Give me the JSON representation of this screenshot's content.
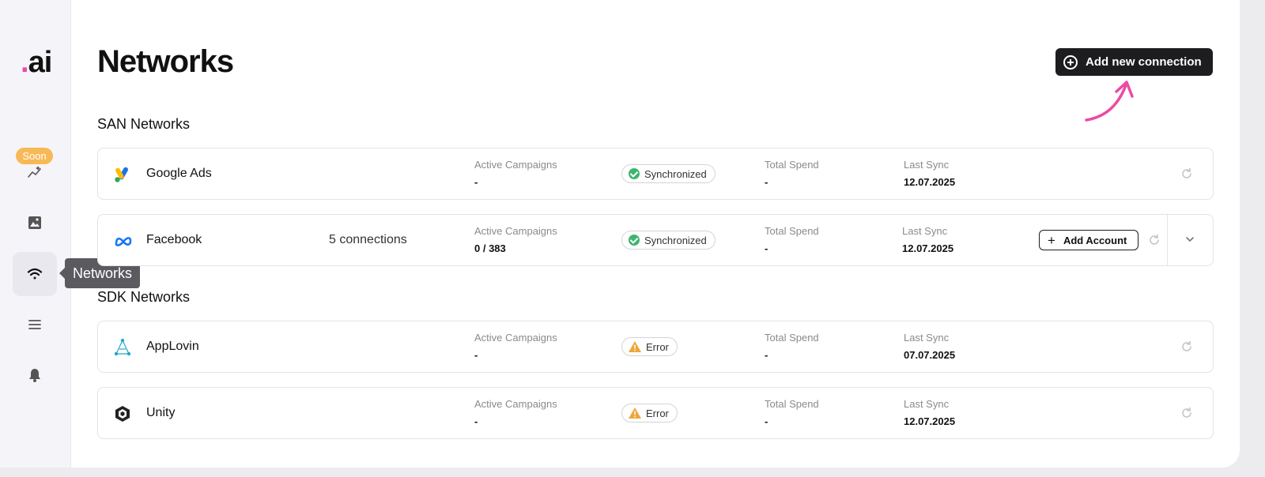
{
  "logo": {
    "dot": ".",
    "text": "ai"
  },
  "sidebar": {
    "soon_badge": "Soon",
    "tooltip": "Networks",
    "items": [
      {
        "name": "analytics",
        "icon": "sparkle-chart-icon"
      },
      {
        "name": "creatives",
        "icon": "image-icon"
      },
      {
        "name": "networks",
        "icon": "wifi-icon",
        "active": true
      },
      {
        "name": "menu",
        "icon": "menu-icon"
      },
      {
        "name": "notifications",
        "icon": "bell-icon"
      }
    ]
  },
  "header": {
    "title": "Networks",
    "add_connection_label": "Add new connection"
  },
  "labels": {
    "active_campaigns": "Active Campaigns",
    "total_spend": "Total Spend",
    "last_sync": "Last Sync",
    "add_account": "Add Account"
  },
  "san": {
    "title": "SAN Networks",
    "rows": [
      {
        "name": "Google Ads",
        "active": "-",
        "status": "Synchronized",
        "spend": "-",
        "sync": "12.07.2025"
      },
      {
        "name": "Facebook",
        "connections": "5 connections",
        "active": "0 / 383",
        "status": "Synchronized",
        "spend": "-",
        "sync": "12.07.2025"
      }
    ]
  },
  "sdk": {
    "title": "SDK Networks",
    "rows": [
      {
        "name": "AppLovin",
        "active": "-",
        "status": "Error",
        "spend": "-",
        "sync": "07.07.2025"
      },
      {
        "name": "Unity",
        "active": "-",
        "status": "Error",
        "spend": "-",
        "sync": "12.07.2025"
      }
    ]
  },
  "colors": {
    "accent_pink": "#ec4aa4",
    "success": "#3fb46f",
    "warning": "#f0a53a",
    "badge_soon": "#f7b955"
  }
}
